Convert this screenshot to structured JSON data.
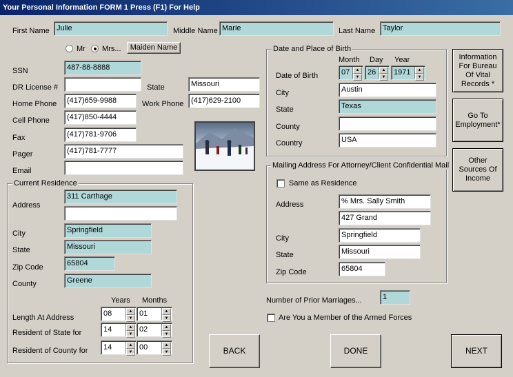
{
  "window": {
    "title": "Your Personal Information  FORM 1   Press (F1) For Help"
  },
  "name": {
    "first_label": "First Name",
    "first_value": "Julie",
    "middle_label": "Middle Name",
    "middle_value": "Marie",
    "last_label": "Last Name",
    "last_value": "Taylor"
  },
  "title_options": {
    "mr": "Mr",
    "mrs": "Mrs...",
    "selected": "Mrs...",
    "maiden_button": "Maiden Name"
  },
  "personal": {
    "ssn_label": "SSN",
    "ssn": "487-88-8888",
    "dl_label": "DR License #",
    "dl": "",
    "state_label": "State",
    "state": "Missouri",
    "home_label": "Home Phone",
    "home": "(417)659-9988",
    "work_label": "Work Phone",
    "work": "(417)629-2100",
    "cell_label": "Cell Phone",
    "cell": "(417)850-4444",
    "fax_label": "Fax",
    "fax": "(417)781-9706",
    "pager_label": "Pager",
    "pager": "(417)781-7777",
    "email_label": "Email",
    "email": ""
  },
  "residence": {
    "title": "Current Residence",
    "address_label": "Address",
    "address1": "311 Carthage",
    "address2": "",
    "city_label": "City",
    "city": "Springfield",
    "state_label": "State",
    "state": "Missouri",
    "zip_label": "Zip Code",
    "zip": "65804",
    "county_label": "County",
    "county": "Greene",
    "years_header": "Years",
    "months_header": "Months",
    "length_label": "Length At Address",
    "length_years": "08",
    "length_months": "01",
    "rs_state_label": "Resident of State for",
    "rs_state_years": "14",
    "rs_state_months": "02",
    "rs_county_label": "Resident of County for",
    "rs_county_years": "14",
    "rs_county_months": "00"
  },
  "birth": {
    "title": "Date and Place of Birth",
    "month_header": "Month",
    "day_header": "Day",
    "year_header": "Year",
    "dob_label": "Date of Birth",
    "month": "07",
    "day": "26",
    "year": "1971",
    "city_label": "City",
    "city": "Austin",
    "state_label": "State",
    "state": "Texas",
    "county_label": "County",
    "county": "",
    "country_label": "Country",
    "country": "USA"
  },
  "mailing": {
    "title": "Mailing Address For Attorney/Client Confidential Mail",
    "same_label": "Same as Residence",
    "address_label": "Address",
    "address1": "% Mrs. Sally Smith",
    "address2": "427 Grand",
    "city_label": "City",
    "city": "Springfield",
    "state_label": "State",
    "state": "Missouri",
    "zip_label": "Zip Code",
    "zip": "65804"
  },
  "marriages": {
    "label": "Number of Prior Marriages...",
    "value": "1"
  },
  "armed": {
    "label": "Are You a Member of the Armed Forces"
  },
  "side_buttons": {
    "vital": "Information For Bureau Of Vital Records *",
    "employment": "Go To Employment*",
    "income": "Other Sources Of Income"
  },
  "nav": {
    "back": "BACK",
    "done": "DONE",
    "next": "NEXT"
  },
  "icons": {
    "photo": "skiing-photo-icon",
    "spin_up": "▲",
    "spin_down": "▼"
  }
}
